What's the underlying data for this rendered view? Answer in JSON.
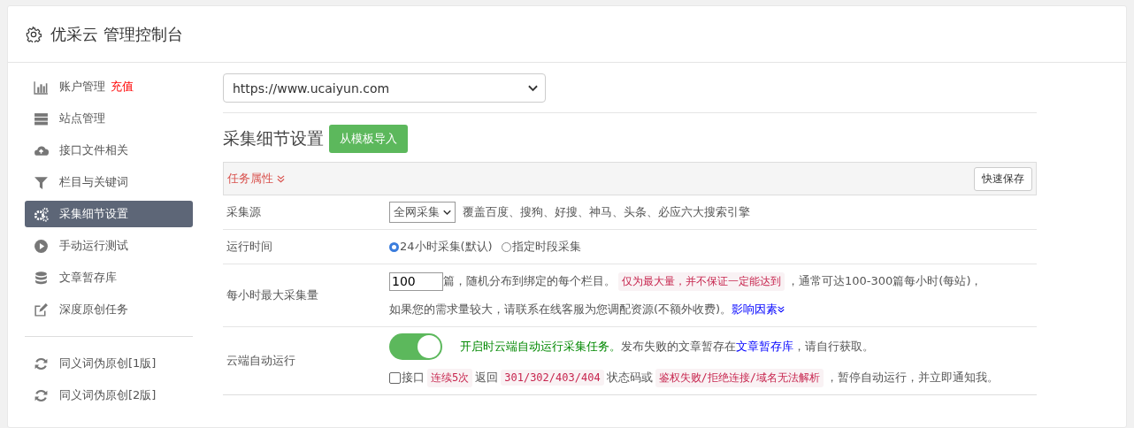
{
  "header": {
    "title": "优采云 管理控制台"
  },
  "sidebar": {
    "sections": [
      {
        "items": [
          {
            "label": "账户管理",
            "badge": "充值",
            "selected": false
          },
          {
            "label": "站点管理",
            "selected": false
          },
          {
            "label": "接口文件相关",
            "selected": false
          },
          {
            "label": "栏目与关键词",
            "selected": false
          },
          {
            "label": "采集细节设置",
            "selected": true
          },
          {
            "label": "手动运行测试",
            "selected": false
          },
          {
            "label": "文章暂存库",
            "selected": false
          },
          {
            "label": "深度原创任务",
            "selected": false
          }
        ]
      },
      {
        "items": [
          {
            "label": "同义词伪原创[1版]",
            "selected": false
          },
          {
            "label": "同义词伪原创[2版]",
            "selected": false
          }
        ]
      }
    ]
  },
  "main": {
    "site_select": {
      "value": "https://www.ucaiyun.com"
    },
    "section_title": "采集细节设置",
    "import_button": "从模板导入",
    "panel": {
      "title": "任务属性",
      "save_button": "快速保存",
      "rows": [
        {
          "kind": "select",
          "label": "采集源",
          "select": "全网采集",
          "note": "覆盖百度、搜狗、好搜、神马、头条、必应六大搜索引擎"
        },
        {
          "kind": "radio",
          "label": "运行时间",
          "options": [
            {
              "label": "24小时采集(默认)",
              "selected": true
            },
            {
              "label": "指定时段采集",
              "selected": false
            }
          ]
        },
        {
          "kind": "lines",
          "label": "每小时最大采集量",
          "lines": [
            [
              {
                "kind": "input",
                "text": "100"
              },
              {
                "kind": "text",
                "text": "篇，随机分布到绑定的每个栏目。"
              },
              {
                "kind": "tag",
                "text": "仅为最大量，并不保证一定能达到"
              },
              {
                "kind": "text",
                "text": "，通常可达100-300篇每小时(每站)，"
              }
            ],
            [
              {
                "kind": "text",
                "text": "如果您的需求量较大，请联系在线客服为您调配资源(不额外收费)。"
              },
              {
                "kind": "link",
                "text": "影响因素",
                "expander": true
              }
            ]
          ]
        },
        {
          "kind": "lines",
          "label": "云端自动运行",
          "lines": [
            [
              {
                "kind": "toggle",
                "on": true
              },
              {
                "kind": "green",
                "text": "开启时云端自动运行采集任务。"
              },
              {
                "kind": "text",
                "text": "发布失败的文章暂存在"
              },
              {
                "kind": "link",
                "text": "文章暂存库"
              },
              {
                "kind": "text",
                "text": "，请自行获取。"
              }
            ],
            [
              {
                "kind": "checkbox",
                "checked": false,
                "text": "接口"
              },
              {
                "kind": "tag",
                "text": "连续5次"
              },
              {
                "kind": "text",
                "text": "返回"
              },
              {
                "kind": "tag",
                "text": "301/302/403/404"
              },
              {
                "kind": "text",
                "text": "状态码或"
              },
              {
                "kind": "tag",
                "text": "鉴权失败/拒绝连接/域名无法解析"
              },
              {
                "kind": "text",
                "text": "，暂停自动运行，并立即通知我。"
              }
            ]
          ]
        }
      ]
    }
  }
}
